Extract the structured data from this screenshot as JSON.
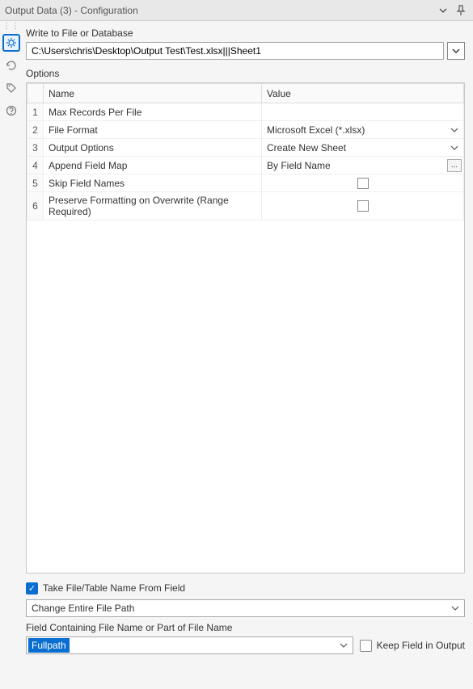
{
  "titlebar": {
    "title": "Output Data (3) - Configuration"
  },
  "write_section_label": "Write to File or Database",
  "file_path": "C:\\Users\\chris\\Desktop\\Output Test\\Test.xlsx|||Sheet1",
  "options_label": "Options",
  "grid": {
    "headers": {
      "name": "Name",
      "value": "Value"
    },
    "rows": [
      {
        "n": "1",
        "name": "Max Records Per File",
        "value": "",
        "kind": "text"
      },
      {
        "n": "2",
        "name": "File Format",
        "value": "Microsoft Excel (*.xlsx)",
        "kind": "dropdown"
      },
      {
        "n": "3",
        "name": "Output Options",
        "value": "Create New Sheet",
        "kind": "dropdown"
      },
      {
        "n": "4",
        "name": "Append Field Map",
        "value": "By Field Name",
        "kind": "ellipsis"
      },
      {
        "n": "5",
        "name": "Skip Field Names",
        "value": "",
        "kind": "checkbox"
      },
      {
        "n": "6",
        "name": "Preserve Formatting on Overwrite (Range Required)",
        "value": "",
        "kind": "checkbox"
      }
    ]
  },
  "bottom": {
    "take_from_field_label": "Take File/Table Name From Field",
    "change_path_value": "Change Entire File Path",
    "field_containing_label": "Field Containing File Name or Part of File Name",
    "field_value": "Fullpath",
    "keep_field_label": "Keep Field in Output"
  }
}
